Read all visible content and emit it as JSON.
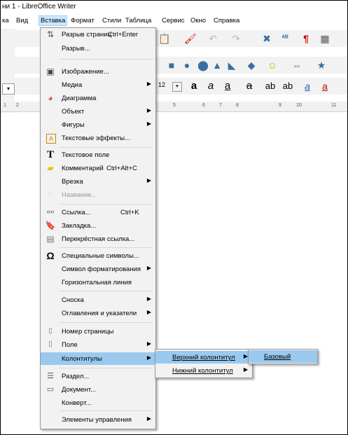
{
  "window": {
    "title": "ни 1 - LibreOffice Writer"
  },
  "menubar": {
    "items": [
      "ка",
      "Вид",
      "Вставка",
      "Формат",
      "Стили",
      "Таблица",
      "Сервис",
      "Окно",
      "Справка"
    ],
    "active": "Вставка"
  },
  "ruler": {
    "ticks": [
      "1",
      "2",
      "5",
      "6",
      "7",
      "8",
      "9",
      "10",
      "11"
    ]
  },
  "font_size_value": "12",
  "insert_menu": {
    "items": [
      {
        "label": "Разрыв страниц",
        "shortcut": "Ctrl+Enter",
        "icon": "page-break-icon"
      },
      {
        "label": "Разрыв...",
        "icon": ""
      },
      {
        "label": "Изображение...",
        "icon": "image-icon"
      },
      {
        "label": "Медиа",
        "icon": "",
        "submenu": true
      },
      {
        "label": "Диаграмма",
        "icon": "chart-icon"
      },
      {
        "label": "Объект",
        "icon": "",
        "submenu": true
      },
      {
        "label": "Фигуры",
        "icon": "",
        "submenu": true
      },
      {
        "label": "Текстовые эффекты...",
        "icon": "fontwork-icon"
      },
      {
        "label": "Текстовое поле",
        "icon": "text-box-icon"
      },
      {
        "label": "Комментарий",
        "shortcut": "Ctrl+Alt+C",
        "icon": "comment-icon"
      },
      {
        "label": "Врезка",
        "icon": "",
        "submenu": true
      },
      {
        "label": "Название...",
        "icon": "caption-icon",
        "disabled": true
      },
      {
        "label": "Ссылка...",
        "shortcut": "Ctrl+K",
        "icon": "hyperlink-icon"
      },
      {
        "label": "Закладка...",
        "icon": "bookmark-icon"
      },
      {
        "label": "Перекрёстная ссылка...",
        "icon": "cross-reference-icon"
      },
      {
        "label": "Специальные символы...",
        "icon": "omega-icon"
      },
      {
        "label": "Символ форматирования",
        "icon": "",
        "submenu": true
      },
      {
        "label": "Горизонтальная линия",
        "icon": ""
      },
      {
        "label": "Сноска",
        "icon": "",
        "submenu": true
      },
      {
        "label": "Оглавления и указатели",
        "icon": "",
        "submenu": true
      },
      {
        "label": "Номер страницы",
        "icon": "page-number-icon"
      },
      {
        "label": "Поле",
        "icon": "field-icon",
        "submenu": true
      },
      {
        "label": "Колонтитулы",
        "icon": "",
        "submenu": true,
        "highlighted": true
      },
      {
        "label": "Раздел...",
        "icon": "section-icon"
      },
      {
        "label": "Документ...",
        "icon": "document-icon"
      },
      {
        "label": "Конверт...",
        "icon": ""
      },
      {
        "label": "Элементы управления",
        "icon": "",
        "submenu": true
      }
    ]
  },
  "headers_footers_submenu": {
    "items": [
      {
        "label": "Верхний колонтитул",
        "submenu": true,
        "highlighted": true
      },
      {
        "label": "Нижний колонтитул",
        "submenu": true
      }
    ]
  },
  "header_submenu": {
    "items": [
      {
        "label": "Базовый",
        "highlighted": true
      }
    ]
  }
}
